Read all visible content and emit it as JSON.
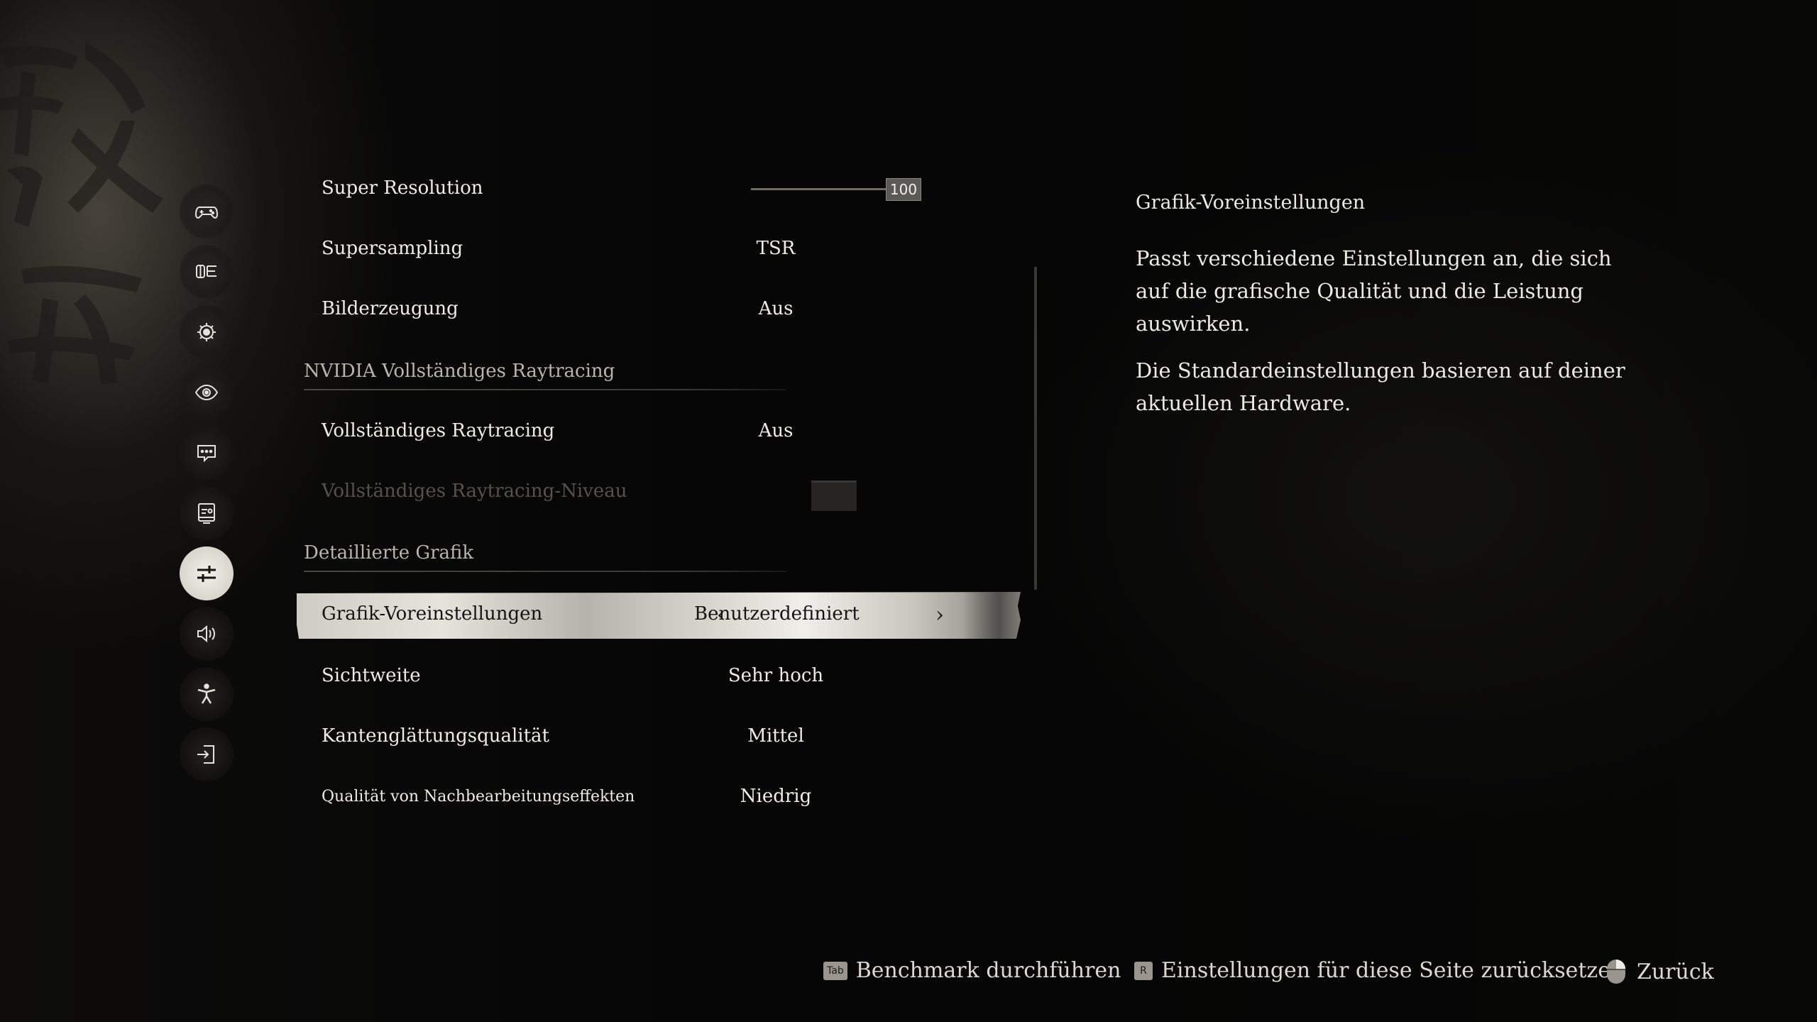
{
  "sidebar": {
    "items": [
      {
        "icon": "gamepad-icon",
        "active": false
      },
      {
        "icon": "display-language-icon",
        "active": false
      },
      {
        "icon": "camera-gear-icon",
        "active": false
      },
      {
        "icon": "eye-icon",
        "active": false
      },
      {
        "icon": "subtitle-icon",
        "active": false
      },
      {
        "icon": "monitor-icon",
        "active": false
      },
      {
        "icon": "sliders-icon",
        "active": true
      },
      {
        "icon": "audio-icon",
        "active": false
      },
      {
        "icon": "accessibility-icon",
        "active": false
      },
      {
        "icon": "exit-icon",
        "active": false
      }
    ]
  },
  "settings": {
    "super_resolution": {
      "label": "Super Resolution",
      "value": "100",
      "slider_percent": 100
    },
    "supersampling": {
      "label": "Supersampling",
      "value": "TSR"
    },
    "frame_generation": {
      "label": "Bilderzeugung",
      "value": "Aus"
    },
    "section_raytracing": "NVIDIA Vollständiges Raytracing",
    "full_raytracing": {
      "label": "Vollständiges Raytracing",
      "value": "Aus"
    },
    "raytracing_level": {
      "label": "Vollständiges Raytracing-Niveau"
    },
    "section_detailed": "Detaillierte Grafik",
    "graphics_preset": {
      "label": "Grafik-Voreinstellungen",
      "value": "Benutzerdefiniert",
      "prev": "‹",
      "next": "›"
    },
    "view_distance": {
      "label": "Sichtweite",
      "value": "Sehr hoch"
    },
    "aa_quality": {
      "label": "Kantenglättungsqualität",
      "value": "Mittel"
    },
    "post_processing": {
      "label": "Qualität von Nachbearbeitungseffekten",
      "value": "Niedrig"
    }
  },
  "description": {
    "title": "Grafik-Voreinstellungen",
    "p1": "Passt verschiedene Einstellungen an, die sich auf die grafische Qualität und die Leistung auswirken.",
    "p2": "Die Standardeinstellungen basieren auf deiner aktuellen Hardware."
  },
  "footer": {
    "benchmark_key": "Tab",
    "benchmark_label": "Benchmark durchführen",
    "reset_key": "R",
    "reset_label": "Einstellungen für diese Seite zurücksetzen",
    "back_label": "Zurück"
  },
  "colors": {
    "background": "#050505",
    "text": "#efece6",
    "selected_text": "#141414",
    "disabled_text": "#55524d"
  }
}
